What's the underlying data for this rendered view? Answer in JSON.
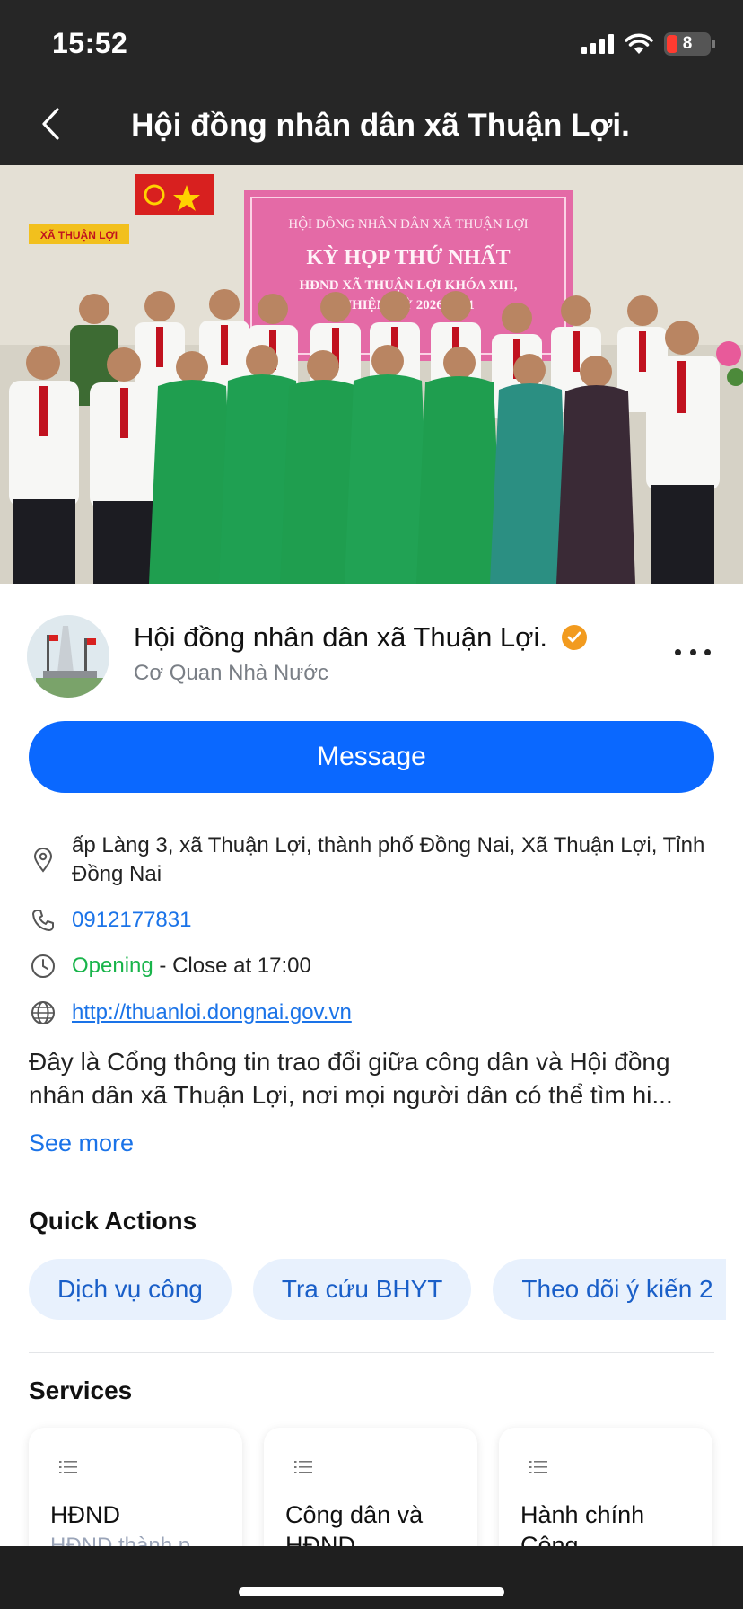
{
  "status_bar": {
    "time": "15:52",
    "battery": "8"
  },
  "nav": {
    "title": "Hội đồng nhân dân xã Thuận Lợi."
  },
  "hero": {
    "banner_line1": "HỘI ĐỒNG NHÂN DÂN XÃ THUẬN LỢI",
    "banner_line2": "KỲ HỌP THỨ NHẤT",
    "banner_line3": "HĐND XÃ THUẬN LỢI KHÓA XIII,",
    "banner_line4": "NHIỆM KỲ 2026-2031",
    "sign": "XÃ THUẬN LỢI"
  },
  "profile": {
    "name": "Hội đồng nhân dân xã Thuận Lợi.",
    "category": "Cơ Quan Nhà Nước",
    "message_label": "Message"
  },
  "info": {
    "address": "ấp Làng 3, xã Thuận Lợi, thành phố Đồng Nai, Xã Thuận Lợi, Tỉnh Đồng Nai",
    "phone": "0912177831",
    "status_open": "Opening",
    "status_close": " - Close at 17:00",
    "website": "http://thuanloi.dongnai.gov.vn"
  },
  "description": "Đây là Cổng thông tin trao đổi giữa công dân và Hội đồng nhân dân xã Thuận Lợi, nơi mọi người dân có thể tìm hi...",
  "see_more": "See more",
  "quick_actions": {
    "title": "Quick Actions",
    "items": [
      "Dịch vụ công",
      "Tra cứu BHYT",
      "Theo dõi ý kiến 2"
    ]
  },
  "services": {
    "title": "Services",
    "items": [
      {
        "title": "HĐND",
        "subtitle": "HĐND thành p..."
      },
      {
        "title": "Công dân và HĐND",
        "subtitle": ""
      },
      {
        "title": "Hành chính Công",
        "subtitle": ""
      }
    ]
  },
  "colors": {
    "accent": "#0a68ff",
    "link": "#1a73e8",
    "open": "#18b44a",
    "verified": "#f29b1f",
    "topbar": "#262626"
  }
}
